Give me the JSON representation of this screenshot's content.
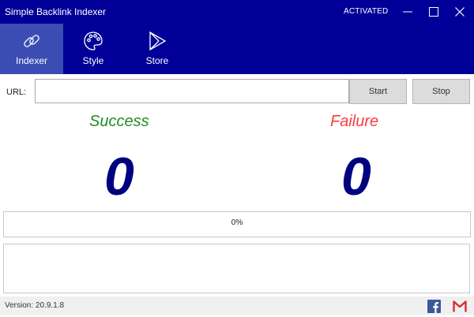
{
  "window": {
    "title": "Simple Backlink Indexer",
    "status": "ACTIVATED",
    "controls": {
      "minimize_icon": "minimize-icon",
      "maximize_icon": "maximize-icon",
      "close_icon": "close-icon"
    }
  },
  "nav": {
    "items": [
      {
        "label": "Indexer",
        "icon": "link-icon",
        "active": true
      },
      {
        "label": "Style",
        "icon": "palette-icon",
        "active": false
      },
      {
        "label": "Store",
        "icon": "store-play-icon",
        "active": false
      }
    ]
  },
  "url_bar": {
    "label": "URL:",
    "value": "",
    "start_label": "Start",
    "stop_label": "Stop"
  },
  "stats": {
    "success_label": "Success",
    "success_value": "0",
    "failure_label": "Failure",
    "failure_value": "0"
  },
  "progress": {
    "text": "0%",
    "value": 0
  },
  "log": {
    "value": ""
  },
  "footer": {
    "version": "Version: 20.9.1.8",
    "facebook_icon": "facebook-icon",
    "gmail_icon": "gmail-icon"
  },
  "colors": {
    "titlebar": "#000099",
    "active_nav": "#3b4db3",
    "success": "#228b22",
    "failure": "#ff3b3b",
    "counter": "#000080"
  }
}
